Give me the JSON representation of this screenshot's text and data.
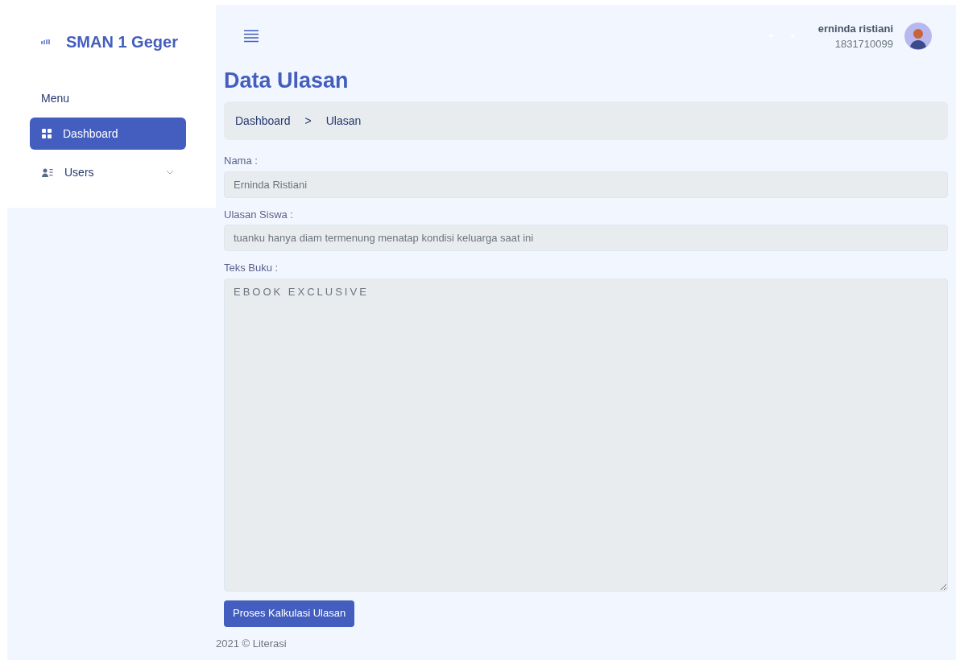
{
  "sidebar": {
    "brand": "SMAN 1 Geger",
    "menu_heading": "Menu",
    "items": [
      {
        "label": "Dashboard",
        "kind": "link",
        "selected": true
      },
      {
        "label": "Users",
        "kind": "dropdown",
        "selected": false
      }
    ]
  },
  "header": {
    "user_name": "erninda ristiani",
    "user_id": "1831710099"
  },
  "page_title": "Data Ulasan",
  "breadcrumb": [
    "Dashboard",
    "Ulasan"
  ],
  "breadcrumb_separator": ">",
  "form": {
    "fields": [
      {
        "label": "Nama :",
        "kind": "input",
        "value": "Erninda Ristiani"
      },
      {
        "label": "Ulasan Siswa :",
        "kind": "input",
        "value": "tuanku hanya diam termenung menatap kondisi keluarga saat ini"
      },
      {
        "label": "Teks Buku :",
        "kind": "textarea",
        "value": "EBOOK EXCLUSIVE"
      }
    ],
    "submit": "Proses Kalkulasi Ulasan"
  },
  "footer": "2021 © Literasi"
}
